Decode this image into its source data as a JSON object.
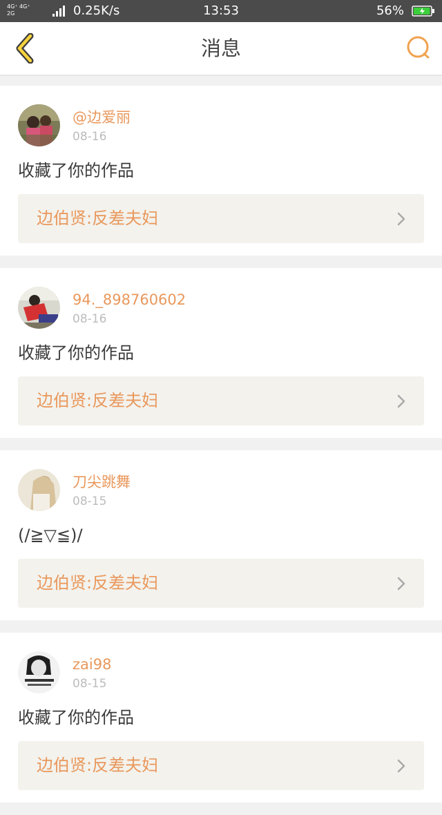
{
  "status_bar": {
    "network_top": "4G⁺ 4G⁺",
    "network_bottom": "2G",
    "speed": "0.25K/s",
    "time": "13:53",
    "battery": "56%",
    "battery_level": 0.56
  },
  "header": {
    "title": "消息",
    "back_icon": "chevron-left-icon",
    "search_icon": "search-icon",
    "accent_color": "#f0a24e"
  },
  "messages": [
    {
      "username": "@边爱丽",
      "date": "08-16",
      "text": "收藏了你的作品",
      "work_title": "边伯贤:反差夫妇"
    },
    {
      "username": "94._898760602",
      "date": "08-16",
      "text": "收藏了你的作品",
      "work_title": "边伯贤:反差夫妇"
    },
    {
      "username": "刀尖跳舞",
      "date": "08-15",
      "text": "(/≧▽≦)/",
      "work_title": "边伯贤:反差夫妇"
    },
    {
      "username": "zai98",
      "date": "08-15",
      "text": "收藏了你的作品",
      "work_title": "边伯贤:反差夫妇"
    }
  ],
  "colors": {
    "username": "#e9985c",
    "work_title": "#e9985c",
    "date": "#bcbcbc",
    "status_bar_bg": "#4b4b4b",
    "link_bg": "#f3f2ed"
  }
}
